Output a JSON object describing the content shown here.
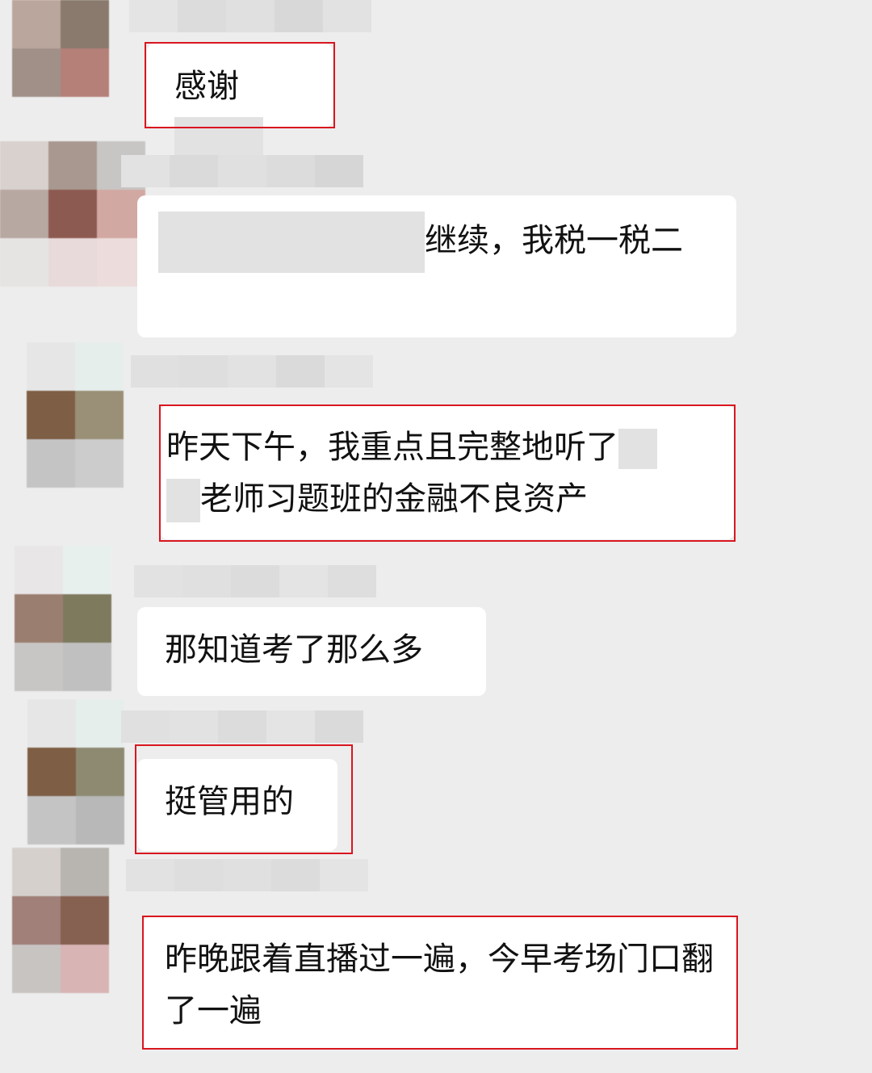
{
  "chat": {
    "messages": [
      {
        "text_before": "感谢",
        "text_after": ""
      },
      {
        "text_before": "",
        "text_after": "继续，我税一税二"
      },
      {
        "text_before": "昨天下午，我重点且完整地听了",
        "text_line2": "老师习题班的金融不良资产"
      },
      {
        "text_before": "那知道考了那么多"
      },
      {
        "text_before": "挺管用的"
      },
      {
        "text_before": "昨晚跟着直播过一遍，今早考场门口翻了一遍"
      }
    ]
  },
  "colors": {
    "background": "#ededed",
    "bubble": "#ffffff",
    "highlight_border": "#d9161f"
  }
}
